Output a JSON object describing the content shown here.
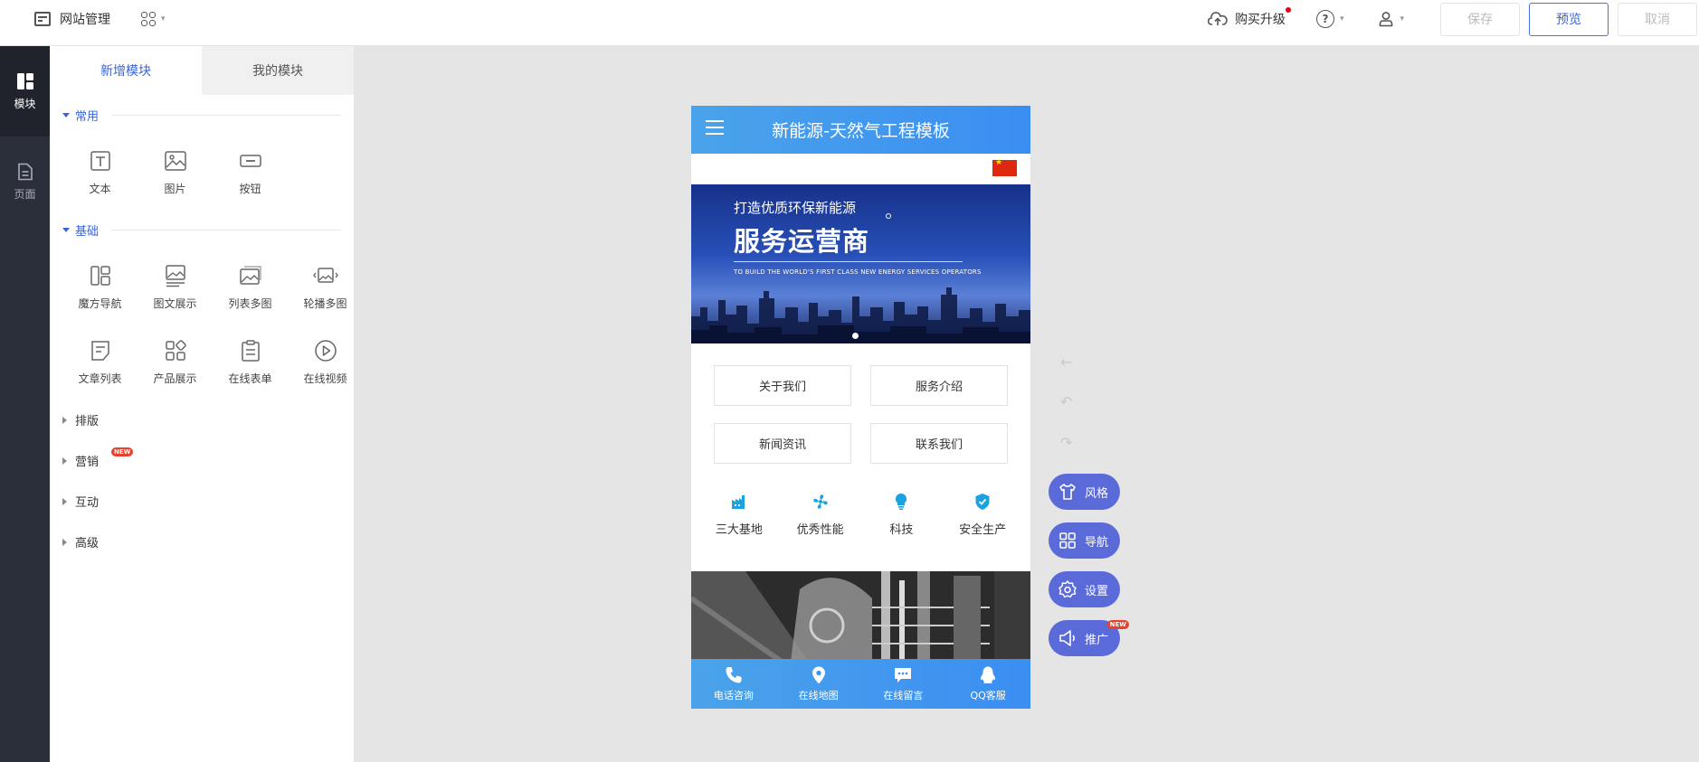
{
  "topbar": {
    "title": "网站管理",
    "buy_label": "购买升级",
    "help_glyph": "?",
    "save_label": "保存",
    "preview_label": "预览",
    "cancel_label": "取消"
  },
  "rail": {
    "items": [
      {
        "label": "模块"
      },
      {
        "label": "页面"
      }
    ]
  },
  "panel": {
    "tabs": [
      {
        "label": "新增模块"
      },
      {
        "label": "我的模块"
      }
    ],
    "sections": {
      "common": {
        "title": "常用",
        "items": [
          {
            "label": "文本"
          },
          {
            "label": "图片"
          },
          {
            "label": "按钮"
          }
        ]
      },
      "basic": {
        "title": "基础",
        "items": [
          {
            "label": "魔方导航"
          },
          {
            "label": "图文展示"
          },
          {
            "label": "列表多图"
          },
          {
            "label": "轮播多图"
          },
          {
            "label": "文章列表"
          },
          {
            "label": "产品展示"
          },
          {
            "label": "在线表单"
          },
          {
            "label": "在线视频"
          }
        ]
      },
      "collapsed": [
        {
          "label": "排版"
        },
        {
          "label": "营销",
          "badge": "NEW"
        },
        {
          "label": "互动"
        },
        {
          "label": "高级"
        }
      ]
    }
  },
  "phone": {
    "title": "新能源-天然气工程模板",
    "banner": {
      "line1": "打造优质环保新能源",
      "line2": "服务运营商",
      "line3": "TO BUILD THE WORLD'S FIRST CLASS NEW ENERGY SERVICES OPERATORS"
    },
    "nav_buttons": [
      {
        "label": "关于我们"
      },
      {
        "label": "服务介绍"
      },
      {
        "label": "新闻资讯"
      },
      {
        "label": "联系我们"
      }
    ],
    "features": [
      {
        "label": "三大基地"
      },
      {
        "label": "优秀性能"
      },
      {
        "label": "科技"
      },
      {
        "label": "安全生产"
      }
    ],
    "footer": [
      {
        "label": "电话咨询"
      },
      {
        "label": "在线地图"
      },
      {
        "label": "在线留言"
      },
      {
        "label": "QQ客服"
      }
    ],
    "accent_color": "#3b8ef2"
  },
  "floating": {
    "items": [
      {
        "label": "风格"
      },
      {
        "label": "导航"
      },
      {
        "label": "设置"
      },
      {
        "label": "推广",
        "badge": "NEW"
      }
    ],
    "color": "#5b6ad9"
  }
}
